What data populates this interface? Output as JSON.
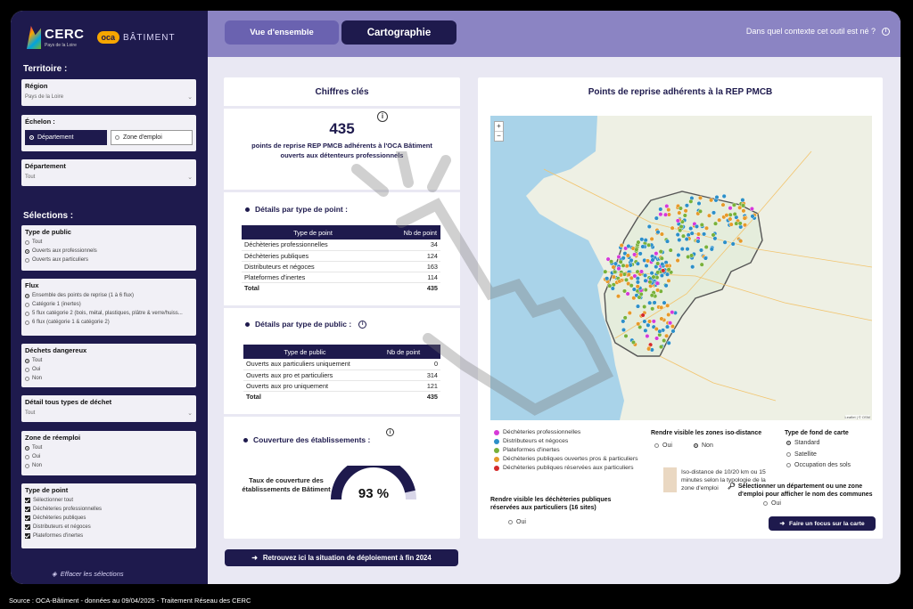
{
  "branding": {
    "cerc": "CERC",
    "cerc_sub": "Pays de la Loire",
    "oca_badge": "oca",
    "oca_text": "BÂTIMENT"
  },
  "sidebar": {
    "territoire_heading": "Territoire :",
    "region": {
      "title": "Région",
      "value": "Pays de la Loire"
    },
    "echelon": {
      "title": "Échelon :",
      "options": [
        "Département",
        "Zone d'emploi"
      ],
      "selected": "Département"
    },
    "departement": {
      "title": "Département",
      "value": "Tout"
    },
    "selections_heading": "Sélections :",
    "type_public": {
      "title": "Type de public",
      "options": [
        "Tout",
        "Ouverts aux professionnels",
        "Ouverts aux particuliers"
      ],
      "selected": 1
    },
    "flux": {
      "title": "Flux",
      "options": [
        "Ensemble des points de reprise (1 à 6 flux)",
        "Catégorie 1 (inertes)",
        "5 flux catégorie 2 (bois, métal, plastiques, plâtre & verre/huiss...",
        "6 flux (catégorie 1 & catégorie 2)"
      ],
      "selected": 0
    },
    "dechets_dangereux": {
      "title": "Déchets dangereux",
      "options": [
        "Tout",
        "Oui",
        "Non"
      ],
      "selected": 0
    },
    "detail_dechet": {
      "title": "Détail tous types de déchet",
      "value": "Tout"
    },
    "zone_reemploi": {
      "title": "Zone de réemploi",
      "options": [
        "Tout",
        "Oui",
        "Non"
      ],
      "selected": 0
    },
    "type_point": {
      "title": "Type de point",
      "options": [
        "Sélectionner tout",
        "Déchèteries professionnelles",
        "Déchèteries publiques",
        "Distributeurs et négoces",
        "Plateformes d'inertes"
      ]
    },
    "clear": "Effacer les sélections"
  },
  "topbar": {
    "tab_overview": "Vue d'ensemble",
    "tab_map": "Cartographie",
    "context": "Dans quel contexte cet outil est né ?"
  },
  "chiffres": {
    "title": "Chiffres clés",
    "total": "435",
    "total_sub_1": "points de reprise REP PMCB adhérents à l'OCA Bâtiment",
    "total_sub_2": "ouverts aux détenteurs professionnels",
    "type_point": {
      "title": "Détails par type de point :",
      "headers": [
        "Type de point",
        "Nb de point"
      ],
      "rows": [
        [
          "Déchèteries professionnelles",
          "34"
        ],
        [
          "Déchèteries publiques",
          "124"
        ],
        [
          "Distributeurs et négoces",
          "163"
        ],
        [
          "Plateformes d'inertes",
          "114"
        ]
      ],
      "total": [
        "Total",
        "435"
      ]
    },
    "type_public": {
      "title": "Détails par type de public :",
      "headers": [
        "Type de public",
        "Nb de point"
      ],
      "rows": [
        [
          "Ouverts aux particuliers uniquement",
          "0"
        ],
        [
          "Ouverts aux pro et particuliers",
          "314"
        ],
        [
          "Ouverts aux pro uniquement",
          "121"
        ]
      ],
      "total": [
        "Total",
        "435"
      ]
    },
    "couverture": {
      "title": "Couverture des établissements :",
      "label": "Taux de couverture des établissements de Bâtiment",
      "value": "93 %",
      "fraction": 0.93
    },
    "cta": "Retrouvez ici la situation de déploiement à fin 2024"
  },
  "map": {
    "title": "Points de reprise adhérents à la REP PMCB",
    "zoom_in": "+",
    "zoom_out": "−",
    "attribution": "Leaflet | © OSM",
    "legend": [
      {
        "label": "Déchèteries professionnelles",
        "color": "#d63ad8"
      },
      {
        "label": "Distributeurs et négoces",
        "color": "#2c8fc8"
      },
      {
        "label": "Plateformes d'inertes",
        "color": "#78b13a"
      },
      {
        "label": "Déchèteries publiques ouvertes pros & particuliers",
        "color": "#e69a2a"
      },
      {
        "label": "Déchèteries publiques réservées aux particuliers",
        "color": "#d42a2a"
      }
    ],
    "iso": {
      "title": "Rendre visible les zones iso-distance",
      "oui": "Oui",
      "non": "Non",
      "text": "Iso-distance de 10/20 km ou 15 minutes selon la typologie de la zone d'emploi"
    },
    "fond": {
      "title": "Type de fond de carte",
      "options": [
        "Standard",
        "Satellite",
        "Occupation des sols"
      ]
    },
    "publiques": {
      "title": "Rendre visible les déchèteries publiques réservées aux particuliers (16 sites)",
      "oui": "Oui"
    },
    "focus": {
      "hint": "Sélectionner un département ou une zone d'emploi pour afficher le nom des communes",
      "oui": "Oui",
      "button": "Faire un focus sur la carte"
    }
  },
  "footer": "Source : OCA-Bâtiment  - données au 09/04/2025 - Traitement Réseau des CERC"
}
